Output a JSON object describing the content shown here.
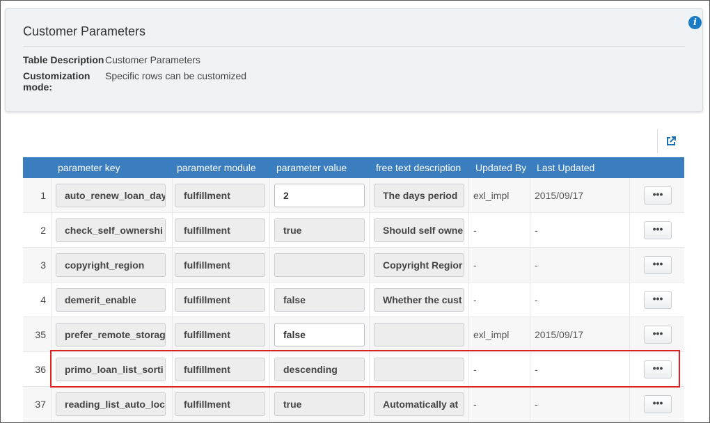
{
  "header": {
    "title": "Customer Parameters",
    "fields": [
      {
        "label": "Table Description",
        "value": "Customer Parameters"
      },
      {
        "label": "Customization mode:",
        "value": "Specific rows can be customized"
      }
    ],
    "info_icon": "info-icon",
    "export_icon": "external-link-icon"
  },
  "table": {
    "columns": [
      "parameter key",
      "parameter module",
      "parameter value",
      "free text description",
      "Updated By",
      "Last Updated"
    ],
    "more_label": "•••",
    "rows": [
      {
        "num": "1",
        "key": "auto_renew_loan_day",
        "module": "fulfillment",
        "value": "2",
        "value_editable": true,
        "description": "The days period",
        "updated_by": "exl_impl",
        "last_updated": "2015/09/17"
      },
      {
        "num": "2",
        "key": "check_self_ownershi",
        "module": "fulfillment",
        "value": "true",
        "value_editable": false,
        "description": "Should self owne",
        "updated_by": "-",
        "last_updated": "-"
      },
      {
        "num": "3",
        "key": "copyright_region",
        "module": "fulfillment",
        "value": "",
        "value_editable": false,
        "description": "Copyright Regior",
        "updated_by": "-",
        "last_updated": "-"
      },
      {
        "num": "4",
        "key": "demerit_enable",
        "module": "fulfillment",
        "value": "false",
        "value_editable": false,
        "description": "Whether the cust",
        "updated_by": "-",
        "last_updated": "-"
      },
      {
        "num": "35",
        "key": "prefer_remote_storag",
        "module": "fulfillment",
        "value": "false",
        "value_editable": true,
        "description": "",
        "updated_by": "exl_impl",
        "last_updated": "2015/09/17"
      },
      {
        "num": "36",
        "key": "primo_loan_list_sorti",
        "module": "fulfillment",
        "value": "descending",
        "value_editable": false,
        "description": "",
        "updated_by": "-",
        "last_updated": "-"
      },
      {
        "num": "37",
        "key": "reading_list_auto_loc",
        "module": "fulfillment",
        "value": "true",
        "value_editable": false,
        "description": "Automatically at",
        "updated_by": "-",
        "last_updated": "-"
      }
    ]
  },
  "colors": {
    "header_bg": "#3a7ebf",
    "highlight": "#e02020",
    "panel_bg": "#f0f3f5"
  }
}
